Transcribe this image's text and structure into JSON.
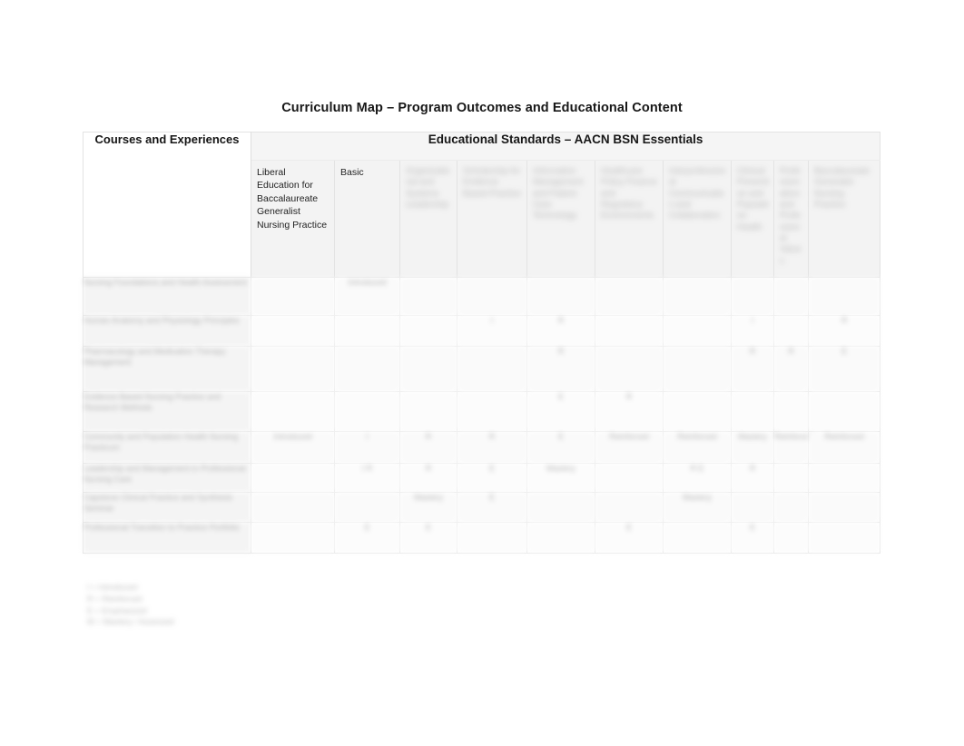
{
  "document": {
    "title": "Curriculum Map – Program Outcomes and Educational Content"
  },
  "table": {
    "corner_header": "Courses and Experiences",
    "standards_banner": "Educational Standards – AACN BSN Essentials",
    "columns": [
      {
        "label": "Liberal Education for Baccalaureate Generalist Nursing Practice",
        "legible": true
      },
      {
        "label": "Basic",
        "legible": true
      },
      {
        "label": "Organizational and Systems Leadership",
        "legible": false
      },
      {
        "label": "Scholarship for Evidence Based Practice",
        "legible": false
      },
      {
        "label": "Information Management and Patient Care Technology",
        "legible": false
      },
      {
        "label": "Healthcare Policy Finance and Regulatory Environments",
        "legible": false
      },
      {
        "label": "Interprofessional Communication and Collaboration",
        "legible": false
      },
      {
        "label": "Clinical Prevention and Population Health",
        "legible": false
      },
      {
        "label": "Professionalism and Professional Values",
        "legible": false
      },
      {
        "label": "Baccalaureate Generalist Nursing Practice",
        "legible": false
      }
    ],
    "rows": [
      {
        "label": "Nursing Foundations and Health Assessment",
        "cells": [
          "",
          "Introduced",
          "",
          "",
          "",
          "",
          "",
          "",
          "",
          ""
        ]
      },
      {
        "label": "Human Anatomy and Physiology Principles",
        "cells": [
          "",
          "",
          "",
          "I",
          "R",
          "",
          "",
          "I",
          "",
          "R"
        ]
      },
      {
        "label": "Pharmacology and Medication Therapy Management",
        "cells": [
          "",
          "",
          "",
          "",
          "R",
          "",
          "",
          "R",
          "R",
          "E"
        ]
      },
      {
        "label": "Evidence Based Nursing Practice and Research Methods",
        "cells": [
          "",
          "",
          "",
          "",
          "E",
          "R",
          "",
          "",
          "",
          ""
        ]
      },
      {
        "label": "Community and Population Health Nursing Practicum",
        "cells": [
          "Introduced",
          "I",
          "R",
          "R",
          "E",
          "Reinforced",
          "Reinforced",
          "Mastery",
          "Reinforced",
          "Reinforced"
        ]
      },
      {
        "label": "Leadership and Management in Professional Nursing Care",
        "cells": [
          "",
          "I R",
          "R",
          "E",
          "Mastery",
          "",
          "R E",
          "R",
          "",
          ""
        ]
      },
      {
        "label": "Capstone Clinical Practice and Synthesis Seminar",
        "cells": [
          "",
          "",
          "Mastery",
          "E",
          "",
          "",
          "Mastery",
          "",
          "",
          ""
        ]
      },
      {
        "label": "Professional Transition to Practice Portfolio",
        "cells": [
          "",
          "E",
          "E",
          "",
          "",
          "E",
          "",
          "E",
          "",
          ""
        ]
      }
    ]
  },
  "legend": {
    "lines": [
      "I = Introduced",
      "R = Reinforced",
      "E = Emphasized",
      "M = Mastery / Assessed"
    ]
  },
  "colors": {
    "page_background": "#ffffff",
    "table_border": "#e3e3e3",
    "header_fill": "#f3f3f3",
    "banner_fill": "#f5f5f5",
    "text": "#171717"
  }
}
